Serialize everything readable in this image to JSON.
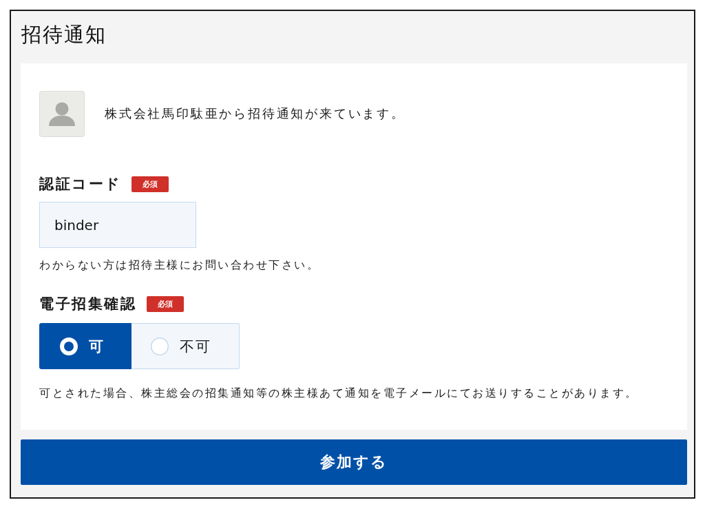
{
  "dialog": {
    "title": "招待通知"
  },
  "invitation": {
    "message": "株式会社馬印駄亜から招待通知が来ています。"
  },
  "fields": [
    {
      "kind": "text",
      "label": "認証コード",
      "badge": "必須",
      "value": "binder",
      "hint": "わからない方は招待主様にお問い合わせ下さい。"
    },
    {
      "kind": "radio",
      "label": "電子招集確認",
      "badge": "必須",
      "options": [
        {
          "label": "可",
          "selected": true
        },
        {
          "label": "不可",
          "selected": false
        }
      ],
      "hint": "可とされた場合、株主総会の招集通知等の株主様あて通知を電子メールにてお送りすることがあります。"
    }
  ],
  "submit_button": {
    "label": "参加する"
  }
}
